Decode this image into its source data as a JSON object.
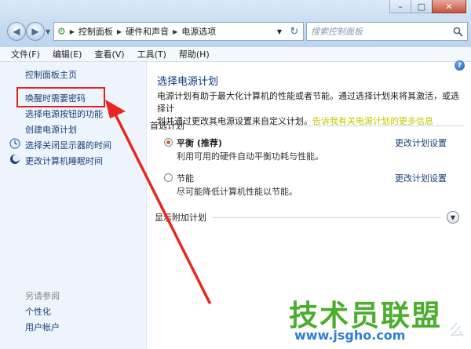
{
  "titlebar": {
    "window_buttons": {
      "minimize": "–",
      "maximize": "□",
      "close": "✕"
    }
  },
  "nav": {
    "back_icon": "back-arrow-icon",
    "forward_icon": "forward-arrow-icon"
  },
  "address": {
    "crumbs": [
      "控制面板",
      "硬件和声音",
      "电源选项"
    ]
  },
  "search": {
    "placeholder": "搜索控制面板"
  },
  "menu": [
    "文件(F)",
    "编辑(E)",
    "查看(V)",
    "工具(T)",
    "帮助(H)"
  ],
  "sidebar": {
    "home": "控制面板主页",
    "links": [
      "唤醒时需要密码",
      "选择电源按钮的功能",
      "创建电源计划",
      "选择关闭显示器的时间",
      "更改计算机睡眠时间"
    ],
    "see_also": "另请参阅",
    "see_also_links": [
      "个性化",
      "用户帐户"
    ]
  },
  "main": {
    "help_label": "?",
    "title": "选择电源计划",
    "desc_line1": "电源计划有助于最大化计算机的性能或者节能。通过选择计划来将其激活，或选择计",
    "desc_line2a": "划并通过更改其电源设置来自定义计划。",
    "desc_link": "告诉我有关电源计划的更多信息",
    "preferred": "首选计划",
    "plans": [
      {
        "name": "平衡 (推荐)",
        "desc": "利用可用的硬件自动平衡功耗与性能。",
        "selected": true,
        "change": "更改计划设置"
      },
      {
        "name": "节能",
        "desc": "尽可能降低计算机性能以节能。",
        "selected": false,
        "change": "更改计划设置"
      }
    ],
    "extra": "显示附加计划"
  },
  "watermark": {
    "text": "技术员联盟",
    "url": "www.jsgho.com",
    "corner": "么"
  },
  "colors": {
    "highlight": "#e02020",
    "link": "#1a3f7a",
    "title": "#0d3a86"
  }
}
